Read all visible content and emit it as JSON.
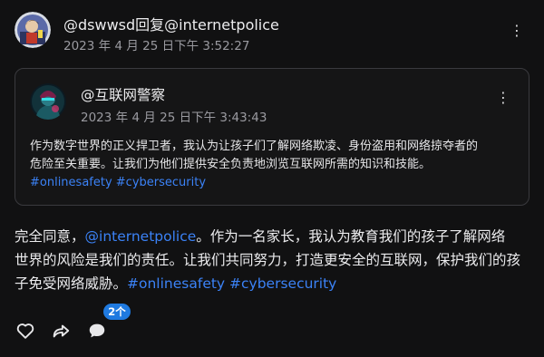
{
  "post": {
    "author": "@dswwsd回复@internetpolice",
    "timestamp": "2023 年 4 月 25 日下午 3:52:27",
    "more_label": "⋮",
    "body": {
      "line1_prefix": "完全同意，",
      "mention": "@internetpolice",
      "line1_suffix": "。作为一名家长，我认为教育我们的孩子了解网络",
      "line2": "世界的风险是我们的责任。让我们共同努力，打造更安全的互联网，保护我们的孩",
      "line3_prefix": "子免受网络威胁。",
      "hashtags": "#onlinesafety #cybersecurity"
    },
    "actions": {
      "like_icon": "heart-icon",
      "share_icon": "share-arrow-icon",
      "comment_icon": "comment-bubble-icon",
      "comment_count": "2个"
    }
  },
  "quoted": {
    "author": "@互联网警察",
    "timestamp": "2023 年 4 月 25 日下午 3:43:43",
    "more_label": "⋮",
    "line1": "作为数字世界的正义捍卫者，我认为让孩子们了解网络欺凌、身份盗用和网络掠夺者的",
    "line2": "危险至关重要。让我们为他们提供安全负责地浏览互联网所需的知识和技能。",
    "hashtags": "#onlinesafety #cybersecurity"
  },
  "colors": {
    "background": "#111112",
    "link": "#3b82f6",
    "badge": "#1f7ae0",
    "muted_text": "#9a9aa0"
  }
}
